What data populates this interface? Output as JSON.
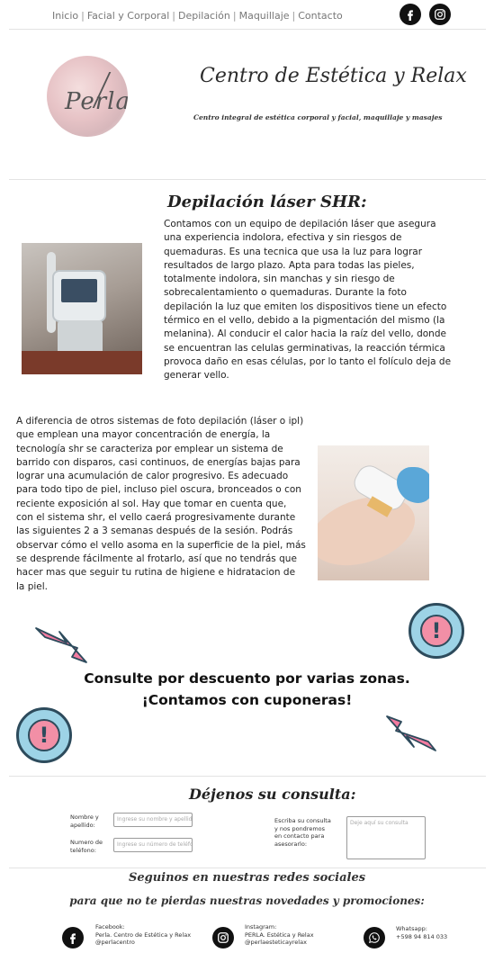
{
  "nav": {
    "links": [
      "Inicio",
      "Facial y Corporal",
      "Depilación",
      "Maquillaje",
      "Contacto"
    ],
    "separator": "|",
    "icons": [
      "facebook-icon",
      "instagram-icon"
    ]
  },
  "header": {
    "logo_text": "Perla",
    "title": "Centro de Estética y Relax",
    "subtitle": "Centro integral de estética corporal y facial, maquillaje y masajes"
  },
  "section": {
    "title": "Depilación láser SHR:",
    "paragraph1": "Contamos con un equipo de depilación láser que asegura una experiencia indolora, efectiva y sin riesgos de quemaduras. Es una tecnica que usa la luz para lograr resultados de largo plazo. Apta para todas las pieles, totalmente indolora, sin manchas y sin riesgo de sobrecalentamiento o quemaduras. Durante la foto depilación la luz que emiten los dispositivos tiene un efecto térmico en el vello, debido a la pigmentación del mismo (la melanina). Al conducir el calor hacia la raíz del vello, donde se encuentran las celulas germinativas, la reacción térmica provoca daño en esas células, por lo tanto el folículo deja de generar vello.",
    "paragraph2": "A diferencia de otros sistemas de foto depilación (láser o ipl) que emplean una mayor concentración de energía, la tecnología shr se caracteriza por emplear un sistema de barrido con disparos, casi continuos, de energías bajas para lograr una acumulación de calor progresivo. Es adecuado para todo tipo de piel, incluso piel oscura, bronceados o con reciente exposición al sol. Hay que tomar en cuenta que, con el sistema shr, el vello caerá progresivamente durante las siguientes 2 a 3 semanas después de la sesión. Podrás observar cómo el vello asoma en la superficie de la piel, más se desprende fácilmente al frotarlo, así que no tendrás que hacer mas que seguir tu rutina de higiene e hidratacion de la piel."
  },
  "promo": {
    "line1": "Consulte por descuento por varias zonas.",
    "line2": "¡Contamos con cuponeras!"
  },
  "contact_form": {
    "title": "Déjenos su consulta:",
    "name_label": "Nombre y apellido:",
    "name_placeholder": "Ingrese su nombre y apellido",
    "phone_label": "Numero de teléfono:",
    "phone_placeholder": "Ingrese su número de teléfono",
    "query_label": "Escriba su consulta y nos pondremos en contacto para asesorarlo:",
    "query_placeholder": "Deje aquí su consulta"
  },
  "footer": {
    "line1": "Seguinos en nuestras redes sociales",
    "line2": "para que no te pierdas nuestras novedades y promociones:",
    "facebook": {
      "label": "Facebook:",
      "name": "Perla. Centro de Estética y Relax",
      "handle": "@perlacentro"
    },
    "instagram": {
      "label": "Instagram:",
      "name": "PERLA. Estética y Relax",
      "handle": "@perlaesteticayrelax"
    },
    "whatsapp": {
      "label": "Whatsapp:",
      "number": "+598 94 814 033"
    }
  },
  "colors": {
    "accent_pink": "#f27ba0",
    "alert_blue": "#9dd3e6",
    "icon_black": "#111111"
  }
}
